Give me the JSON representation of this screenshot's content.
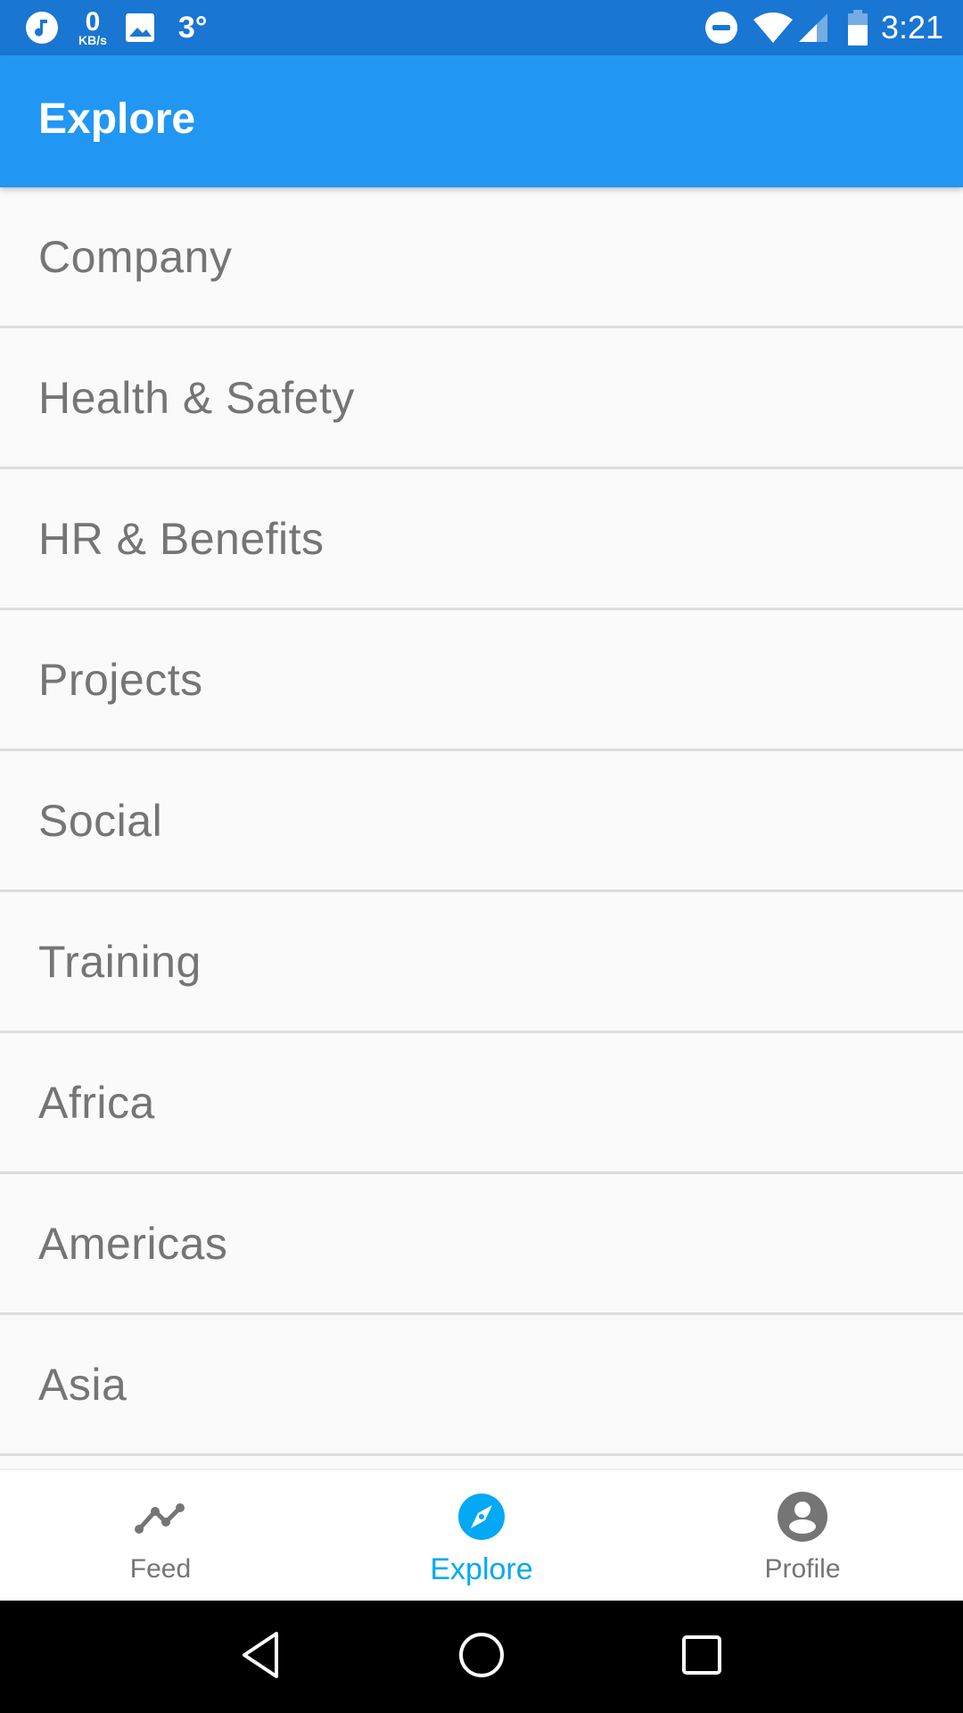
{
  "status_bar": {
    "left_icons": [
      "music-note-icon",
      "image-icon"
    ],
    "net_speed_value": "0",
    "net_speed_unit": "KB/s",
    "temperature": "3°",
    "right_icons": [
      "do-not-disturb-icon",
      "wifi-icon",
      "cell-signal-icon",
      "battery-icon"
    ],
    "time": "3:21"
  },
  "app_bar": {
    "title": "Explore",
    "color": "#2196F3"
  },
  "list": {
    "items": [
      {
        "label": "Company"
      },
      {
        "label": "Health & Safety"
      },
      {
        "label": "HR & Benefits"
      },
      {
        "label": "Projects"
      },
      {
        "label": "Social"
      },
      {
        "label": "Training"
      },
      {
        "label": "Africa"
      },
      {
        "label": "Americas"
      },
      {
        "label": "Asia"
      }
    ]
  },
  "bottom_nav": {
    "active_color": "#03A9F4",
    "inactive_color": "#757575",
    "items": [
      {
        "label": "Feed",
        "icon": "trending-line-icon",
        "active": false
      },
      {
        "label": "Explore",
        "icon": "compass-icon",
        "active": true
      },
      {
        "label": "Profile",
        "icon": "account-circle-icon",
        "active": false
      }
    ]
  },
  "system_nav": {
    "buttons": [
      "back",
      "home",
      "recents"
    ]
  }
}
